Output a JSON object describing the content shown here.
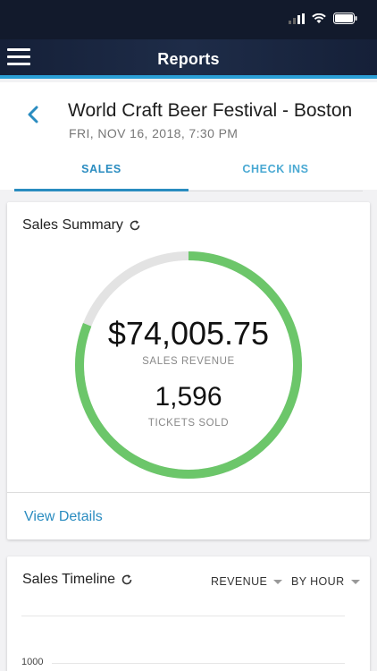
{
  "status": {
    "signal_icon": "signal-icon",
    "wifi_icon": "wifi-icon",
    "battery_icon": "battery-icon"
  },
  "nav": {
    "title": "Reports",
    "menu_icon": "hamburger-menu-icon"
  },
  "event": {
    "title": "World Craft Beer Festival - Boston",
    "date": "FRI, NOV 16, 2018, 7:30 PM"
  },
  "tabs": [
    {
      "label": "SALES",
      "active": true
    },
    {
      "label": "CHECK INS",
      "active": false
    }
  ],
  "summary": {
    "title": "Sales Summary",
    "revenue": "$74,005.75",
    "revenue_label": "SALES REVENUE",
    "tickets": "1,596",
    "tickets_label": "TICKETS SOLD",
    "progress_fraction": 0.81,
    "view_details": "View Details"
  },
  "timeline": {
    "title": "Sales Timeline",
    "metric_dropdown": "REVENUE",
    "interval_dropdown": "BY HOUR",
    "y_tick": "1000"
  },
  "colors": {
    "accent": "#2a8cc0",
    "nav_bg": "#152038",
    "progress": "#6cc66a",
    "track": "#e3e3e3"
  }
}
